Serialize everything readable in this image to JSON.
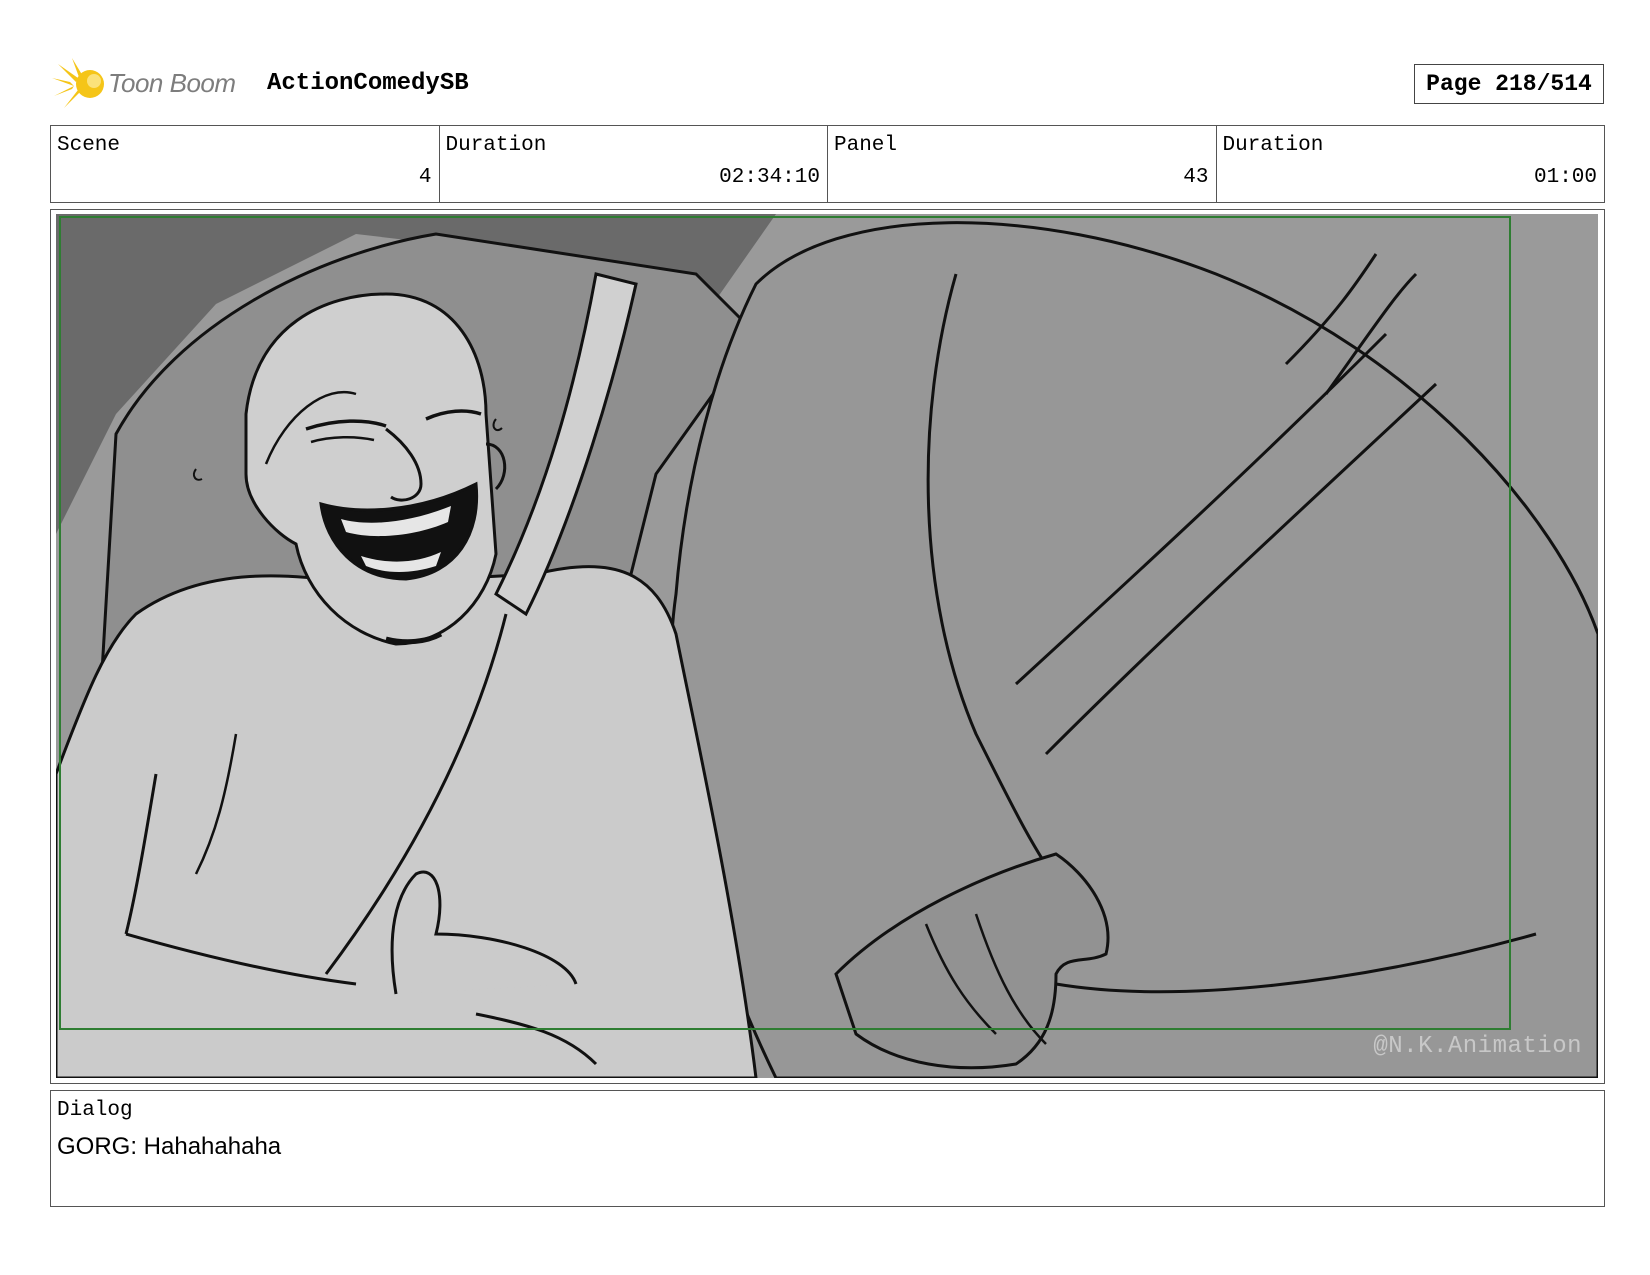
{
  "header": {
    "logo_text": "Toon Boom",
    "project_title": "ActionComedySB",
    "page_indicator": "Page 218/514"
  },
  "info": {
    "scene_label": "Scene",
    "scene_value": "4",
    "scene_duration_label": "Duration",
    "scene_duration_value": "02:34:10",
    "panel_label": "Panel",
    "panel_value": "43",
    "panel_duration_label": "Duration",
    "panel_duration_value": "01:00"
  },
  "panel": {
    "watermark": "@N.K.Animation",
    "safe_frame_color": "#2e7d32"
  },
  "dialog": {
    "label": "Dialog",
    "text": "GORG: Hahahahaha"
  },
  "icons": {
    "logo": "toon-boom-star-icon"
  },
  "colors": {
    "logo_yellow": "#f5c518",
    "logo_text": "#7d7d7d"
  }
}
